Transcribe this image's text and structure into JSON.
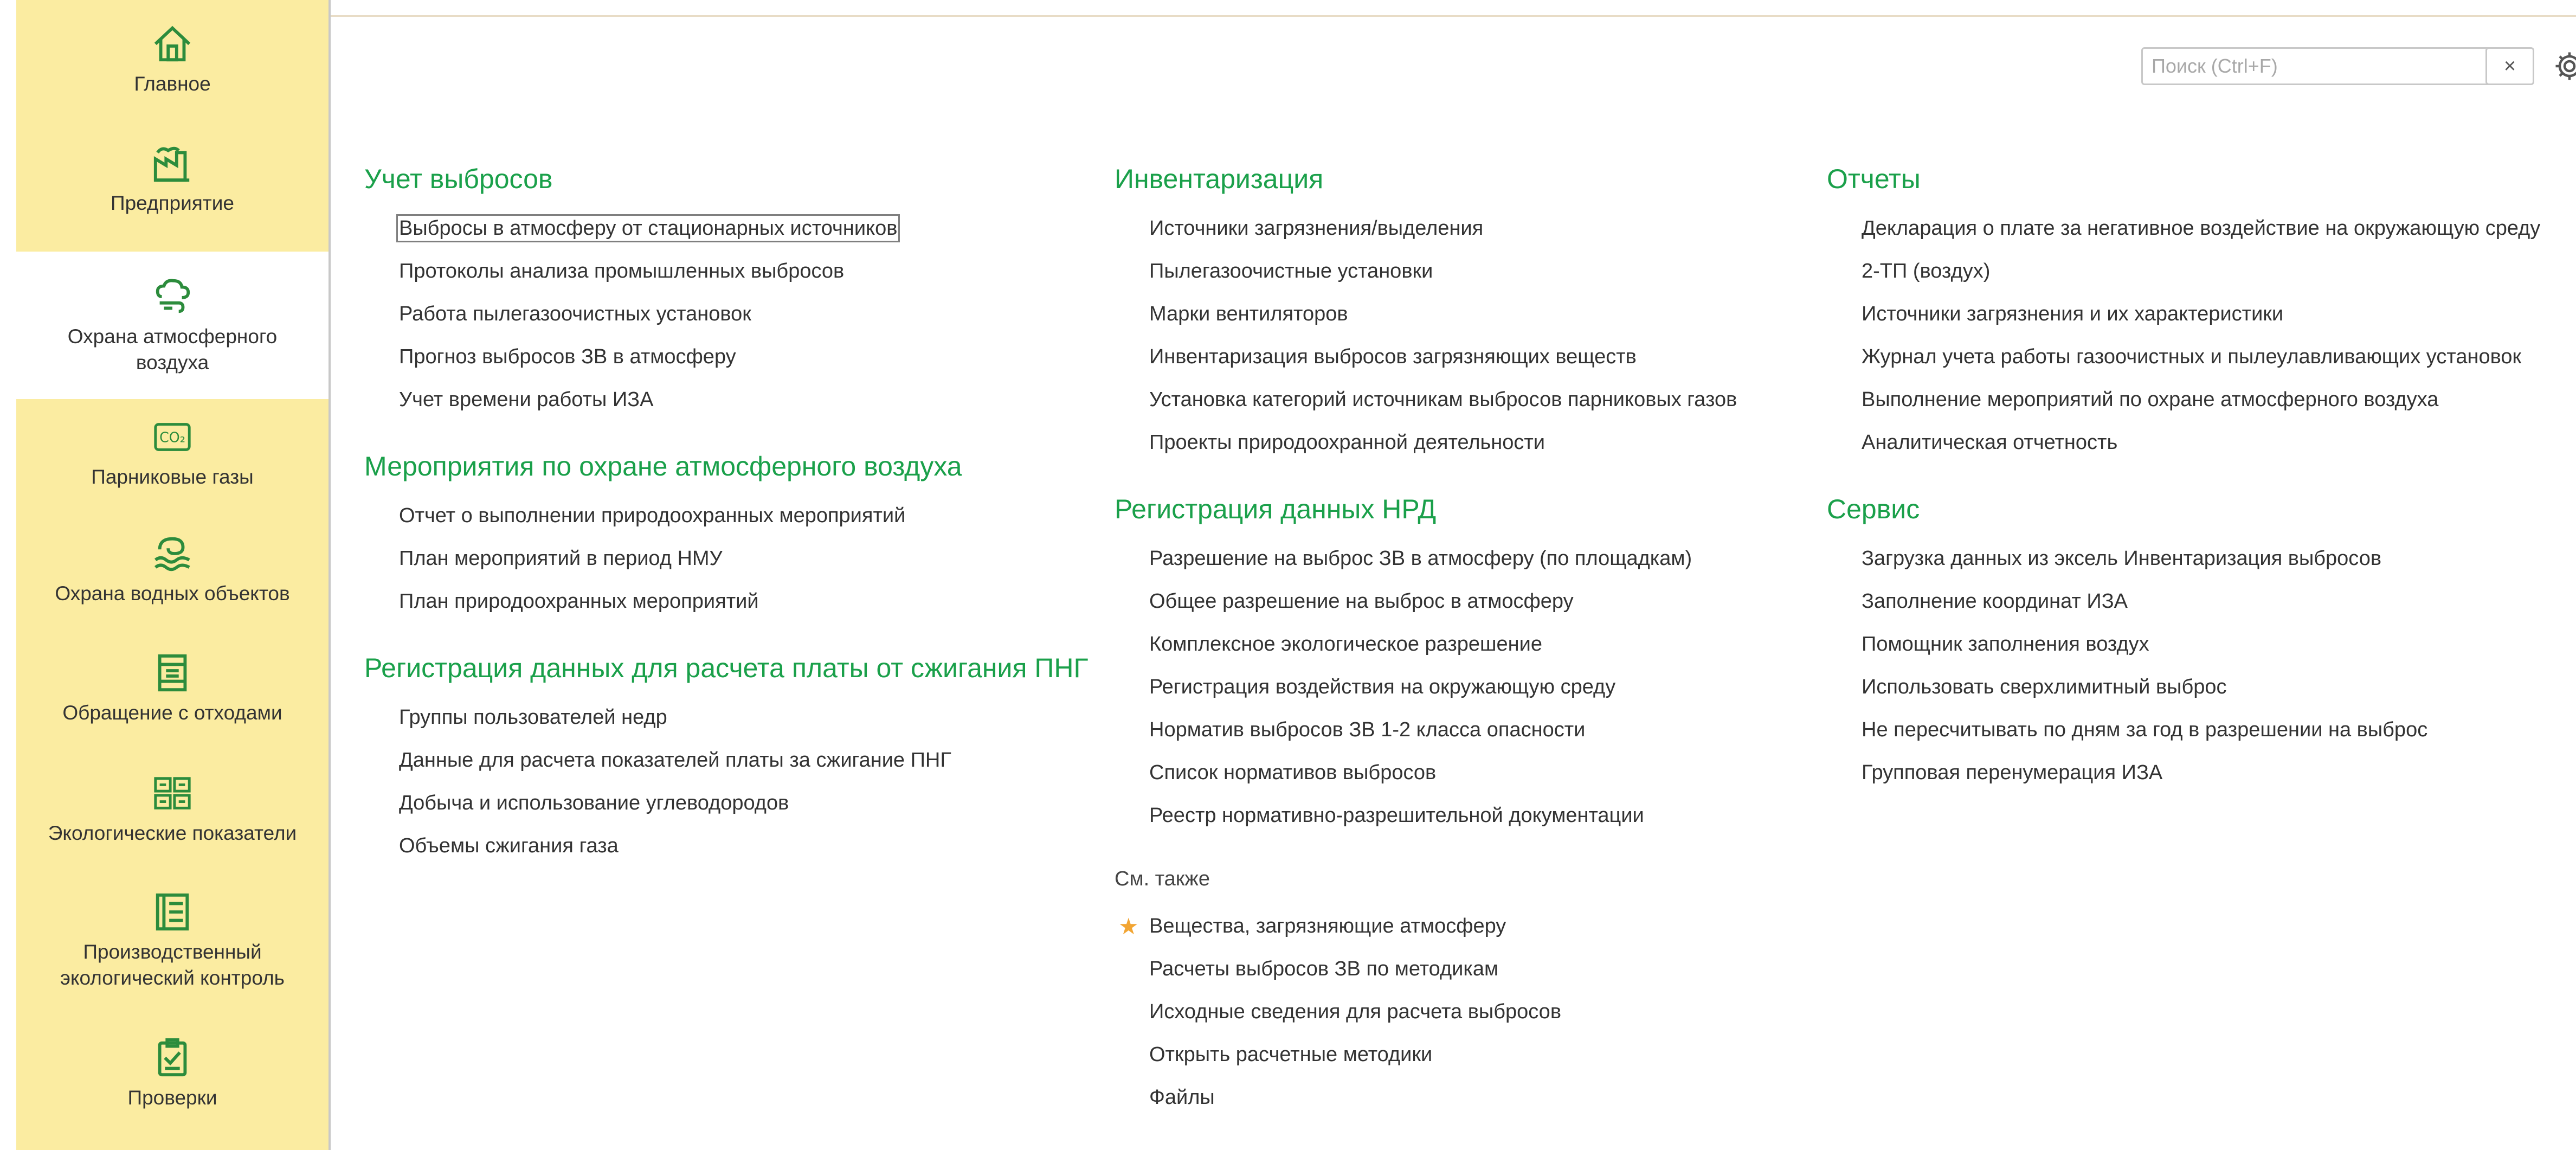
{
  "sidebar": {
    "items": [
      {
        "label": "Главное",
        "icon": "home-icon"
      },
      {
        "label": "Предприятие",
        "icon": "factory-icon"
      },
      {
        "label": "Охрана атмосферного воздуха",
        "icon": "air-icon",
        "active": true
      },
      {
        "label": "Парниковые газы",
        "icon": "co2-icon"
      },
      {
        "label": "Охрана водных объектов",
        "icon": "water-icon"
      },
      {
        "label": "Обращение с отходами",
        "icon": "waste-icon"
      },
      {
        "label": "Экологические показатели",
        "icon": "indicators-icon"
      },
      {
        "label": "Производственный экологический контроль",
        "icon": "control-icon"
      },
      {
        "label": "Проверки",
        "icon": "inspection-icon"
      }
    ]
  },
  "search": {
    "placeholder": "Поиск (Ctrl+F)",
    "value": "",
    "clear_label": "×"
  },
  "columns": [
    {
      "groups": [
        {
          "title": "Учет выбросов",
          "links": [
            "Выбросы в атмосферу от стационарных источников",
            "Протоколы анализа промышленных выбросов",
            "Работа пылегазоочистных установок",
            "Прогноз выбросов ЗВ в атмосферу",
            "Учет времени работы ИЗА"
          ]
        },
        {
          "title": "Мероприятия по охране атмосферного воздуха",
          "links": [
            "Отчет о выполнении природоохранных мероприятий",
            "План мероприятий в период НМУ",
            "План природоохранных мероприятий"
          ]
        },
        {
          "title": "Регистрация данных для расчета платы от сжигания ПНГ",
          "links": [
            "Группы пользователей недр",
            "Данные для расчета показателей платы за сжигание ПНГ",
            "Добыча и использование углеводородов",
            "Объемы сжигания газа"
          ]
        }
      ]
    },
    {
      "groups": [
        {
          "title": "Инвентаризация",
          "links": [
            "Источники загрязнения/выделения",
            "Пылегазоочистные установки",
            "Марки вентиляторов",
            "Инвентаризация выбросов загрязняющих веществ",
            "Установка категорий источникам выбросов парниковых газов",
            "Проекты природоохранной деятельности"
          ]
        },
        {
          "title": "Регистрация данных НРД",
          "links": [
            "Разрешение на выброс ЗВ в атмосферу (по площадкам)",
            "Общее разрешение на выброс в атмосферу",
            "Комплексное экологическое разрешение",
            "Регистрация воздействия на окружающую среду",
            "Норматив выбросов ЗВ 1-2 класса опасности",
            "Список нормативов выбросов",
            "Реестр нормативно-разрешительной документации"
          ]
        }
      ],
      "see_also": {
        "title": "См. также",
        "links": [
          "Вещества, загрязняющие атмосферу",
          "Расчеты выбросов ЗВ по методикам",
          "Исходные сведения для расчета выбросов",
          "Открыть расчетные методики",
          "Файлы"
        ],
        "star_glyph": "★"
      }
    },
    {
      "groups": [
        {
          "title": "Отчеты",
          "links": [
            "Декларация о плате за негативное воздействие на окружающую среду",
            "2-ТП (воздух)",
            "Источники загрязнения и их характеристики",
            "Журнал учета работы газоочистных и пылеулавливающих установок",
            "Выполнение мероприятий по охране атмосферного воздуха",
            "Аналитическая отчетность"
          ]
        },
        {
          "title": "Сервис",
          "links": [
            "Загрузка данных из эксель Инвентаризация выбросов",
            "Заполнение координат ИЗА",
            "Помощник заполнения воздух",
            "Использовать сверхлимитный выброс",
            "Не пересчитывать по дням за год в разрешении на выброс",
            "Групповая перенумерация ИЗА"
          ]
        }
      ]
    }
  ],
  "colors": {
    "accent": "#1aa04a",
    "sidebar": "#fbeca1",
    "star": "#f2a533"
  }
}
